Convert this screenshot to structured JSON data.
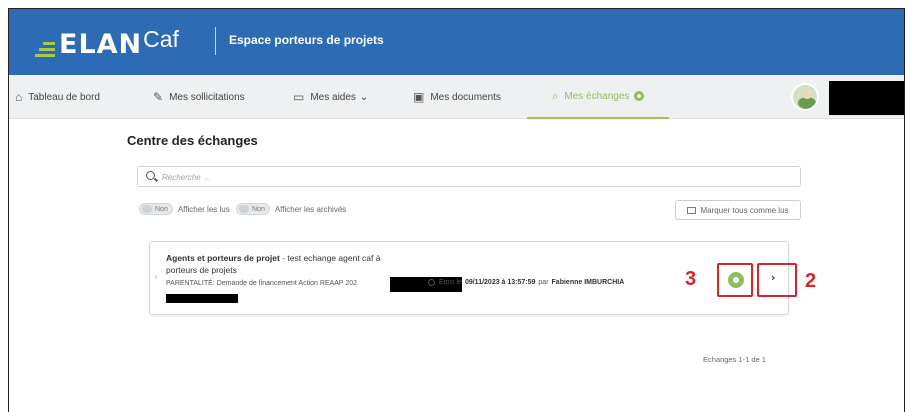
{
  "header": {
    "logo_main": "ELAN",
    "logo_suffix": "Caf",
    "title": "Espace porteurs de projets",
    "bar_color": "#2d6bb5",
    "logo_accent": "#a9c94a"
  },
  "nav": {
    "items": [
      {
        "label": "Tableau de bord",
        "icon": "home-icon"
      },
      {
        "label": "Mes sollicitations",
        "icon": "pencil-icon"
      },
      {
        "label": "Mes aides",
        "icon": "folder-icon",
        "dropdown": "⌄"
      },
      {
        "label": "Mes documents",
        "icon": "document-icon"
      },
      {
        "label": "Mes échanges",
        "icon": "chat-icon",
        "active": true
      }
    ],
    "active_color": "#8fbf5a"
  },
  "main": {
    "page_title": "Centre des échanges",
    "search_placeholder": "Recherche ...",
    "filters": [
      {
        "state": "Non",
        "label": "Afficher les lus"
      },
      {
        "state": "Non",
        "label": "Afficher les archivés"
      }
    ],
    "mark_all_label": "Marquer tous comme lus"
  },
  "exchange": {
    "title_bold": "Agents et porteurs de projet",
    "title_rest": " - test echange agent caf à porteurs de projets",
    "subtitle": "PARENTALITÉ: Demande de financement Action REAAP 202",
    "meta_prefix": "Emis le",
    "date": "09/11/2023 à 13:57:59",
    "meta_by": "par",
    "author": "Fabienne IMBURCHIA",
    "next_glyph": "›"
  },
  "annotations": {
    "left": "3",
    "right": "2",
    "color": "#d6262c"
  },
  "pager": {
    "text": "Echanges 1-1 de 1"
  }
}
